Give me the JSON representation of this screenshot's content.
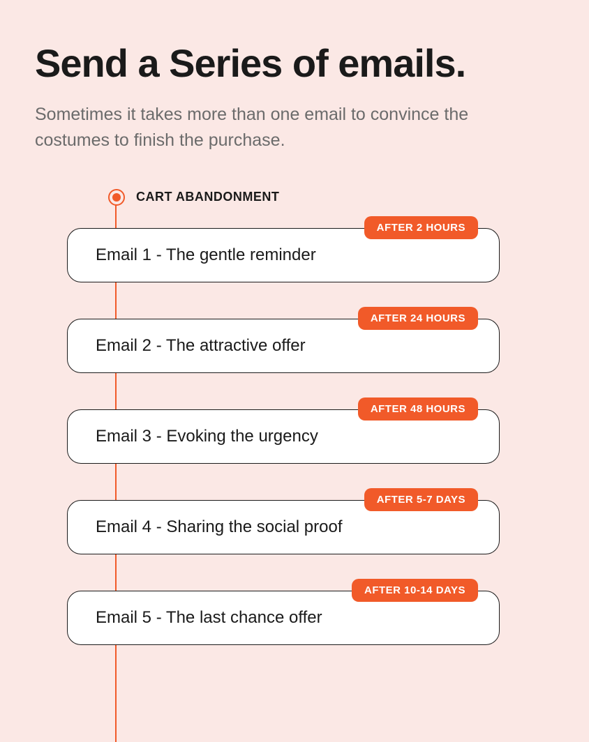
{
  "title": "Send a Series of emails.",
  "subtitle": "Sometimes it takes more than one email to convince the costumes to finish the purchase.",
  "start_label": "CART ABANDONMENT",
  "colors": {
    "accent": "#f15a29",
    "background": "#fbe8e5"
  },
  "steps": [
    {
      "label": "Email 1 - The gentle reminder",
      "badge": "AFTER 2 HOURS"
    },
    {
      "label": "Email 2 - The attractive offer",
      "badge": "AFTER 24 HOURS"
    },
    {
      "label": "Email 3 - Evoking the urgency",
      "badge": "AFTER 48 HOURS"
    },
    {
      "label": "Email 4 - Sharing the social proof",
      "badge": "AFTER 5-7 DAYS"
    },
    {
      "label": "Email 5 - The last chance offer",
      "badge": "AFTER 10-14 DAYS"
    }
  ]
}
